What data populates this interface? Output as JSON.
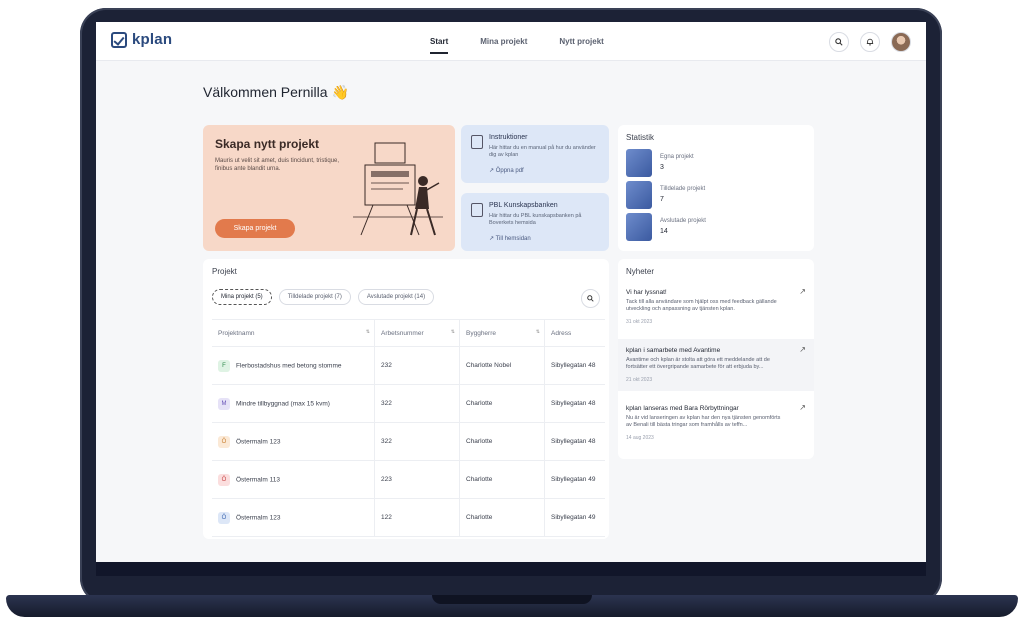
{
  "nav": {
    "logo": "kplan",
    "tabs": [
      "Start",
      "Mina projekt",
      "Nytt projekt"
    ],
    "active_tab": "Start"
  },
  "welcome": {
    "text": "Välkommen Pernilla",
    "emoji": "👋"
  },
  "create": {
    "title": "Skapa nytt projekt",
    "desc": "Mauris ut velit sit amet, duis tincidunt, tristique, finibus ante blandit urna.",
    "button": "Skapa projekt"
  },
  "info_cards": [
    {
      "title": "Instruktioner",
      "desc": "Här hittar du en manual på hur du använder dig av kplan",
      "link": "Öppna pdf"
    },
    {
      "title": "PBL Kunskapsbanken",
      "desc": "Här hittar du PBL kunskapsbanken på Boverkets hemsida",
      "link": "Till hemsidan"
    }
  ],
  "stats": {
    "title": "Statistik",
    "items": [
      {
        "label": "Egna projekt",
        "value": "3"
      },
      {
        "label": "Tilldelade projekt",
        "value": "7"
      },
      {
        "label": "Avslutade projekt",
        "value": "14"
      }
    ]
  },
  "projects": {
    "title": "Projekt",
    "chips": [
      "Mina projekt (5)",
      "Tilldelade projekt (7)",
      "Avslutade projekt (14)"
    ],
    "columns": [
      "Projektnamn",
      "Arbetsnummer",
      "Byggherre",
      "Adress"
    ],
    "rows": [
      {
        "icon": "F",
        "name": "Flerbostadshus med betong stomme",
        "number": "232",
        "owner": "Charlotte Nobel",
        "address": "Sibyllegatan 48"
      },
      {
        "icon": "M",
        "name": "Mindre tillbyggnad (max 15 kvm)",
        "number": "322",
        "owner": "Charlotte",
        "address": "Sibyllegatan 48"
      },
      {
        "icon": "Ö",
        "name": "Östermalm 123",
        "number": "322",
        "owner": "Charlotte",
        "address": "Sibyllegatan 48"
      },
      {
        "icon": "Ö",
        "name": "Östermalm 113",
        "number": "223",
        "owner": "Charlotte",
        "address": "Sibyllegatan 49"
      },
      {
        "icon": "Ö",
        "name": "Östermalm 123",
        "number": "122",
        "owner": "Charlotte",
        "address": "Sibyllegatan 49"
      }
    ],
    "row_colors": [
      "#dff3e4",
      "#e6e2f7",
      "#fbe9d6",
      "#fbdede",
      "#dde7f7"
    ],
    "row_text_colors": [
      "#2f8a4c",
      "#6a55b8",
      "#c98033",
      "#c84646",
      "#3e68b0"
    ]
  },
  "news": {
    "title": "Nyheter",
    "items": [
      {
        "title": "Vi har lyssnat!",
        "desc": "Tack till alla användare som hjälpt oss med feedback gällande utveckling och anpassning av tjänsten kplan.",
        "date": "31 okt 2023"
      },
      {
        "title": "kplan i samarbete med Avantime",
        "desc": "Avantime och kplan är stolta att göra ett meddelande att de fortsätter ett övergripande samarbete för att erbjuda by...",
        "date": "21 okt 2023"
      },
      {
        "title": "kplan lanseras med Bara Rörbyttningar",
        "desc": "Nu är vid lanseringen av kplan har den nya tjänsten genomförts av Benali till bästa tringar som framhålls av teffn...",
        "date": "14 aug 2023"
      }
    ]
  }
}
